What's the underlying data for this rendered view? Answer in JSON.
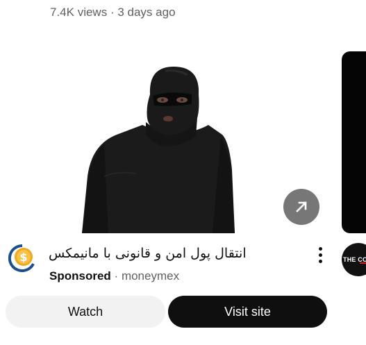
{
  "top_meta": {
    "views": "7.4K views",
    "separator": "·",
    "age": "3 days ago"
  },
  "ad": {
    "title": "انتقال پول امن و قانونی با مانیمکس",
    "sponsored_label": "Sponsored",
    "separator": "·",
    "advertiser": "moneymex",
    "watch_label": "Watch",
    "visit_label": "Visit site"
  },
  "next_card": {
    "channel_text": "THE CO"
  },
  "icons": {
    "open": "arrow-up-right-icon",
    "more": "more-vert-icon",
    "logo": "dollar-coin-logo"
  },
  "colors": {
    "secondary_text": "#606060",
    "primary_text": "#0f0f0f",
    "watch_bg": "#f2f2f2",
    "visit_bg": "#0f0f0f",
    "logo_gold": "#f2a81d",
    "logo_blue": "#1a4e8c"
  }
}
